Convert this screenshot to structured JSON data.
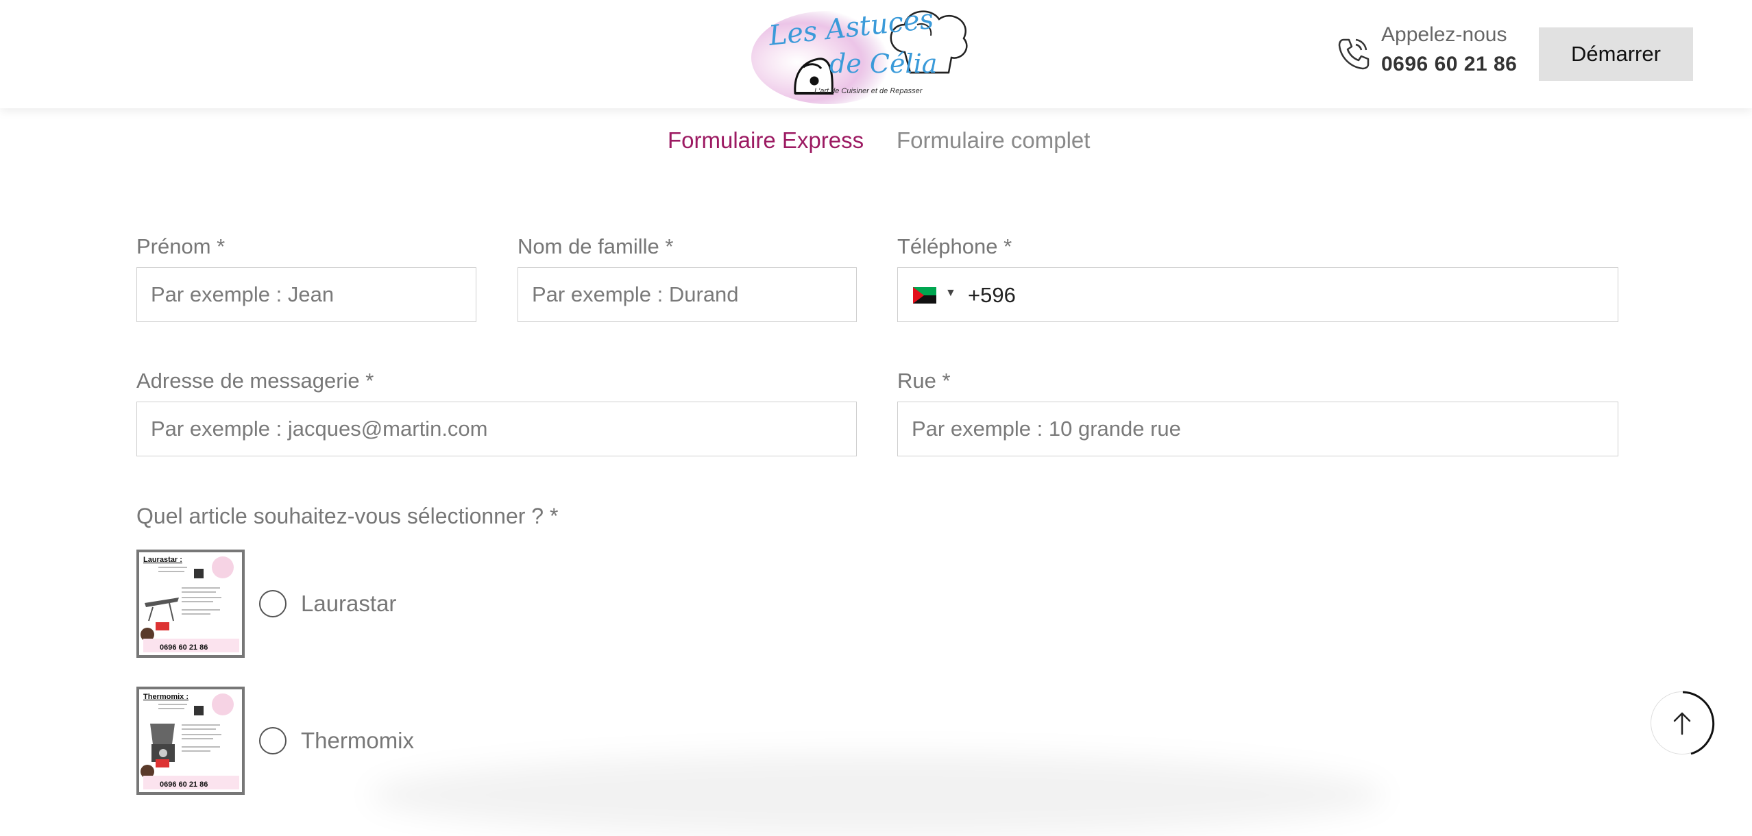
{
  "header": {
    "logo": {
      "line1": "Les Astuces",
      "line2": "de Célia",
      "tagline": "L'art de Cuisiner et de Repasser"
    },
    "call_label": "Appelez-nous",
    "call_number": "0696 60 21 86",
    "start_button": "Démarrer"
  },
  "tabs": [
    {
      "label": "Formulaire Express",
      "active": true
    },
    {
      "label": "Formulaire complet",
      "active": false
    }
  ],
  "form": {
    "first_name": {
      "label": "Prénom *",
      "placeholder": "Par exemple : Jean"
    },
    "last_name": {
      "label": "Nom de famille *",
      "placeholder": "Par exemple : Durand"
    },
    "phone": {
      "label": "Téléphone *",
      "value": "+596",
      "country_flag": "martinique-flag-icon"
    },
    "email": {
      "label": "Adresse de messagerie *",
      "placeholder": "Par exemple : jacques@martin.com"
    },
    "street": {
      "label": "Rue *",
      "placeholder": "Par exemple : 10 grande rue"
    },
    "article_question": "Quel article souhaitez-vous sélectionner ? *",
    "options": [
      {
        "label": "Laurastar",
        "thumb_title": "Laurastar :",
        "thumb_phone": "0696 60 21 86"
      },
      {
        "label": "Thermomix",
        "thumb_title": "Thermomix :",
        "thumb_phone": "0696 60 21 86"
      }
    ]
  },
  "colors": {
    "accent": "#9c1a62",
    "tab_inactive": "#8a8a8a",
    "button_bg": "#e1e1e1",
    "logo_blue": "#3a9ad9",
    "logo_pink": "#e0489a"
  }
}
